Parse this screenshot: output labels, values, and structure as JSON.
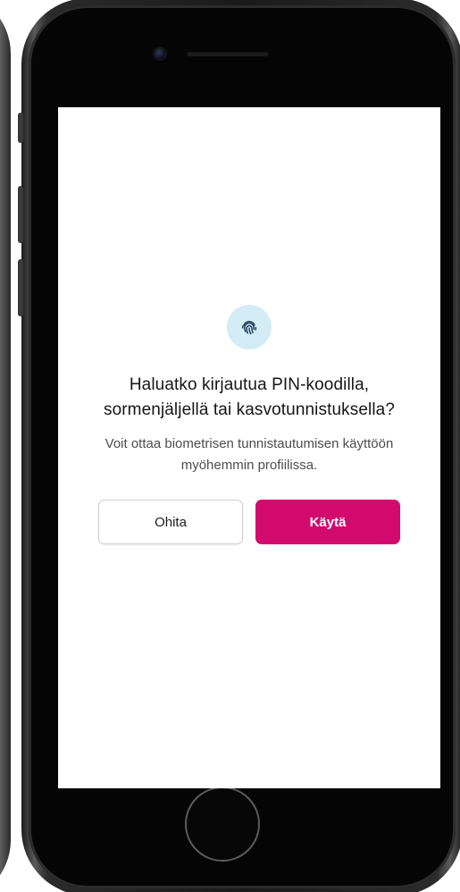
{
  "dialog": {
    "title": "Haluatko kirjautua PIN-koodilla, sormenjäljellä tai kasvotunnistuksella?",
    "description": "Voit ottaa biometrisen tunnistautumisen käyttöön myöhemmin profiilissa.",
    "skip_label": "Ohita",
    "use_label": "Käytä",
    "icon": "fingerprint-icon"
  },
  "colors": {
    "primary": "#d30a6e",
    "icon_bg": "#d3ecf6",
    "icon_fg": "#1f3c57"
  }
}
